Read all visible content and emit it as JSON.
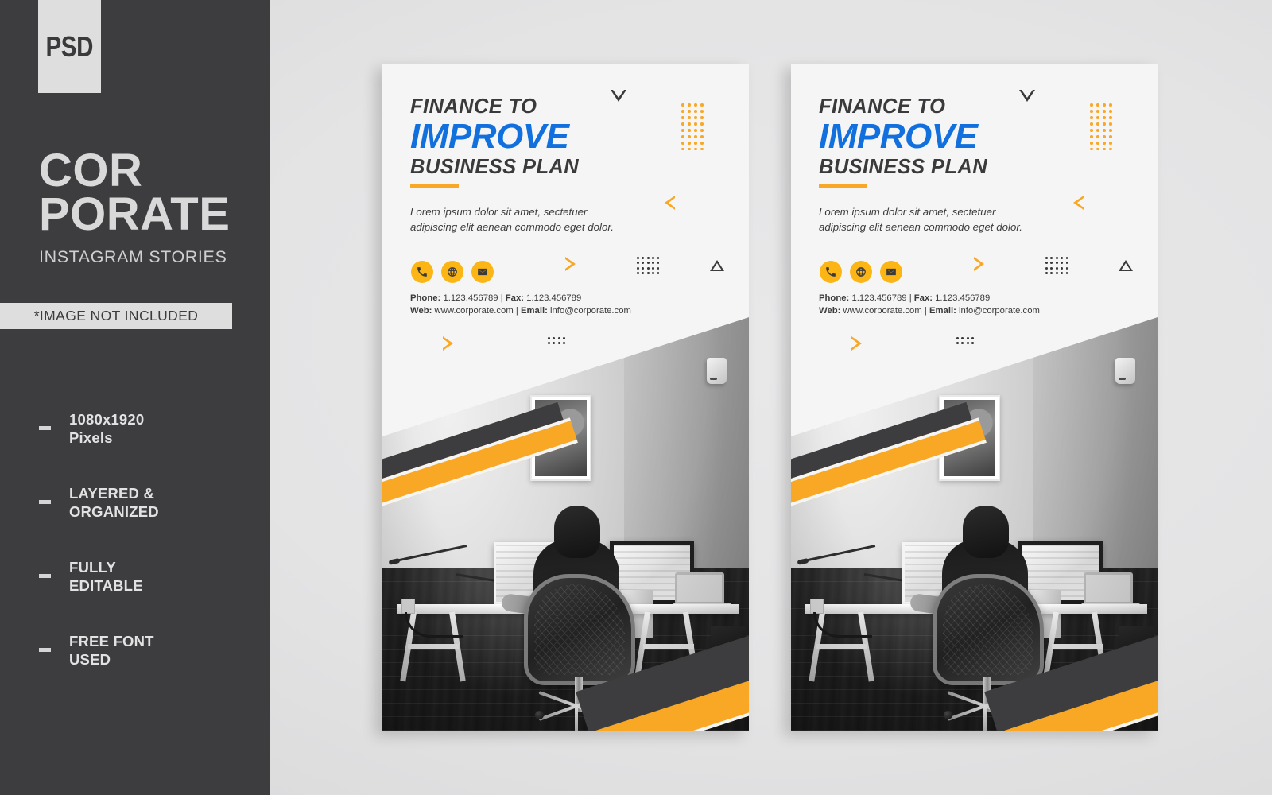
{
  "sidebar": {
    "badge": "PSD",
    "brand_line_1": "COR",
    "brand_line_2": "PORATE",
    "brand_subtitle": "INSTAGRAM STORIES",
    "notice": "*IMAGE NOT INCLUDED",
    "features": [
      {
        "label": "1080x1920\nPixels"
      },
      {
        "label": "LAYERED &\nORGANIZED"
      },
      {
        "label": "FULLY\nEDITABLE"
      },
      {
        "label": "FREE FONT\nUSED"
      }
    ]
  },
  "poster": {
    "headline_top": "FINANCE TO",
    "headline_main": "IMPROVE",
    "headline_bottom": "BUSINESS PLAN",
    "lead": "Lorem ipsum dolor sit amet, sectetuer\nadipiscing elit aenean commodo  eget dolor.",
    "social_icons": [
      {
        "name": "phone-icon"
      },
      {
        "name": "globe-icon"
      },
      {
        "name": "envelope-icon"
      }
    ],
    "contact": {
      "phone_label": "Phone:",
      "phone_value": "1.123.456789",
      "separator": "|",
      "fax_label": "Fax:",
      "fax_value": "1.123.456789",
      "web_label": "Web:",
      "web_value": "www.corporate.com",
      "email_label": "Email:",
      "email_value": "info@corporate.com"
    }
  },
  "colors": {
    "sidebar_bg": "#3d3d40",
    "canvas_bg": "#e2e2e3",
    "accent_blue": "#1170dd",
    "accent_yellow": "#f9a825",
    "icon_yellow": "#fbb515",
    "dark": "#3a3a3c",
    "panel": "#f5f5f5",
    "light_text": "#d9d9da"
  }
}
